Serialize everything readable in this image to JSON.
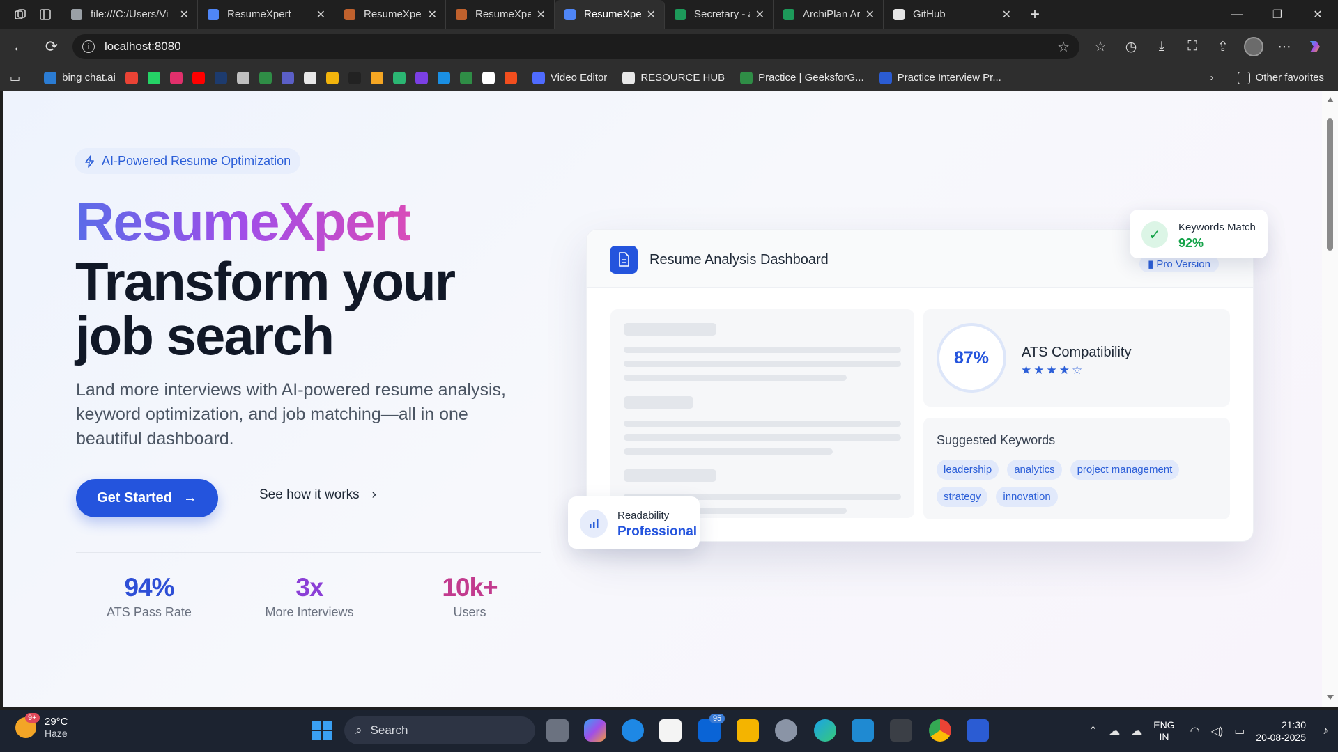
{
  "browser": {
    "tabs": [
      {
        "title": "file:///C:/Users/Vi",
        "color": "#9aa0a6",
        "active": false
      },
      {
        "title": "ResumeXpert",
        "color": "#4f86f7",
        "active": false
      },
      {
        "title": "ResumeXpert – Cl",
        "color": "#c0612d",
        "active": false
      },
      {
        "title": "ResumeXpert – Cl",
        "color": "#c0612d",
        "active": false
      },
      {
        "title": "ResumeXpert",
        "color": "#4f86f7",
        "active": true
      },
      {
        "title": "Secretary - adzun",
        "color": "#1d9a5a",
        "active": false
      },
      {
        "title": "ArchiPlan Archite",
        "color": "#1d9a5a",
        "active": false
      },
      {
        "title": "GitHub",
        "color": "#e6e6e6",
        "active": false
      }
    ],
    "url": "localhost:8080",
    "favorites": [
      {
        "label": "bing chat.ai",
        "color": "#2b7cd3"
      },
      {
        "label": "",
        "color": "#ea4335"
      },
      {
        "label": "",
        "color": "#25d366"
      },
      {
        "label": "",
        "color": "#e1306c"
      },
      {
        "label": "",
        "color": "#ff0000"
      },
      {
        "label": "",
        "color": "#1d3b6e"
      },
      {
        "label": "",
        "color": "#bfbfbf"
      },
      {
        "label": "",
        "color": "#2f8d46"
      },
      {
        "label": "",
        "color": "#5b5fc7"
      },
      {
        "label": "",
        "color": "#e8e8e8"
      },
      {
        "label": "",
        "color": "#f2b40c"
      },
      {
        "label": "",
        "color": "#222222"
      },
      {
        "label": "",
        "color": "#f5a623"
      },
      {
        "label": "",
        "color": "#2bb673"
      },
      {
        "label": "",
        "color": "#7b3fe4"
      },
      {
        "label": "",
        "color": "#1a8fe3"
      },
      {
        "label": "",
        "color": "#2f8d46"
      },
      {
        "label": "",
        "color": "#ffffff"
      },
      {
        "label": "",
        "color": "#f24e1e"
      }
    ],
    "favorites_named": [
      {
        "label": "Video Editor",
        "color": "#4f6bff"
      },
      {
        "label": "RESOURCE HUB",
        "color": "#e8e8e8"
      },
      {
        "label": "Practice | GeeksforG...",
        "color": "#2f8d46"
      },
      {
        "label": "Practice Interview Pr...",
        "color": "#2b5cd3"
      }
    ],
    "other_favorites": "Other favorites"
  },
  "hero": {
    "badge": "AI-Powered Resume Optimization",
    "brand": "ResumeXpert",
    "title": "Transform your job search",
    "description": "Land more interviews with AI-powered resume analysis, keyword optimization, and job matching—all in one beautiful dashboard.",
    "cta_primary": "Get Started",
    "cta_secondary": "See how it works",
    "stats": [
      {
        "value": "94%",
        "label": "ATS Pass Rate",
        "color": "#2e4fd6"
      },
      {
        "value": "3x",
        "label": "More Interviews",
        "color": "#8b3fd6"
      },
      {
        "value": "10k+",
        "label": "Users",
        "color": "#c23b8e"
      }
    ]
  },
  "dashboard": {
    "title": "Resume Analysis Dashboard",
    "pro_label": "Pro Version",
    "ats_score": "87%",
    "ats_title": "ATS Compatibility",
    "ats_rating": 4,
    "ats_rating_max": 5,
    "keywords_title": "Suggested Keywords",
    "keywords": [
      "leadership",
      "analytics",
      "project management",
      "strategy",
      "innovation"
    ],
    "keywords_match_label": "Keywords Match",
    "keywords_match_value": "92%",
    "readability_label": "Readability",
    "readability_value": "Professional"
  },
  "taskbar": {
    "weather_temp": "29°C",
    "weather_desc": "Haze",
    "weather_badge": "9+",
    "search_placeholder": "Search",
    "mail_badge": "95",
    "lang_1": "ENG",
    "lang_2": "IN",
    "time": "21:30",
    "date": "20-08-2025"
  }
}
